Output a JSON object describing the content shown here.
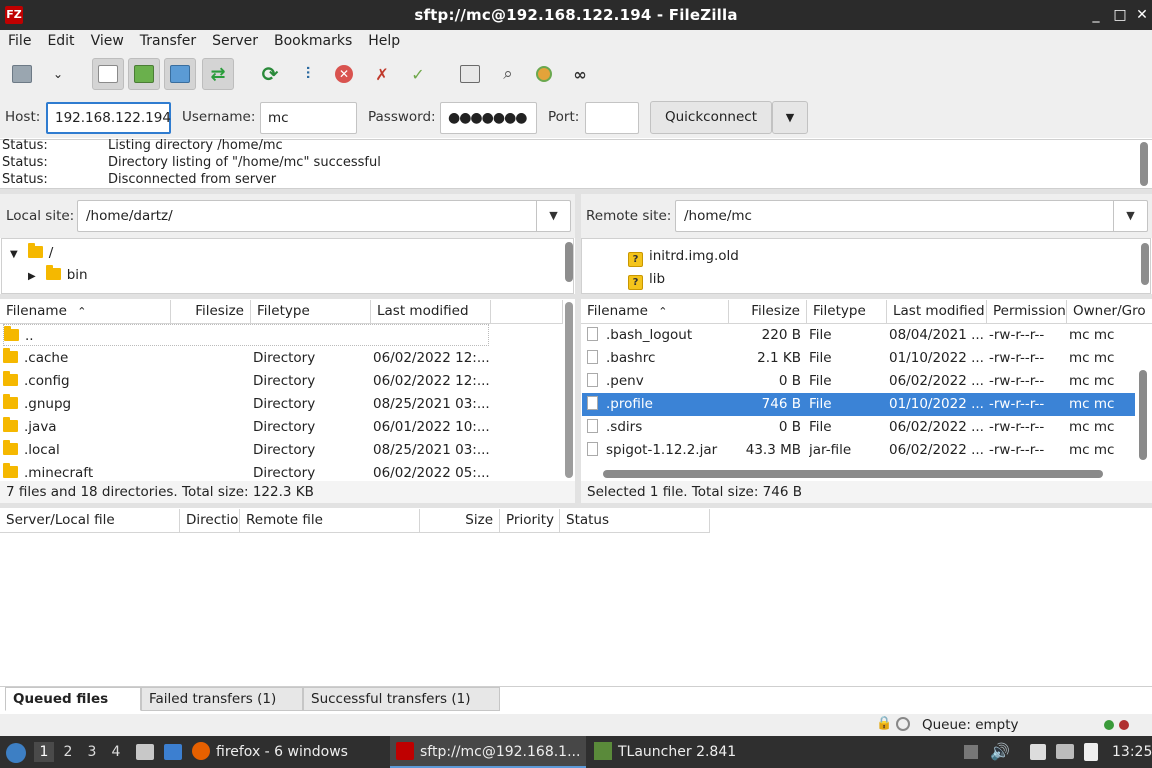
{
  "window": {
    "title": "sftp://mc@192.168.122.194 - FileZilla",
    "logo": "FZ",
    "buttons": [
      "_",
      "□",
      "✕"
    ]
  },
  "menu": [
    "File",
    "Edit",
    "View",
    "Transfer",
    "Server",
    "Bookmarks",
    "Help"
  ],
  "quickconnect": {
    "host_label": "Host:",
    "host_value": "192.168.122.194",
    "username_label": "Username:",
    "username_value": "mc",
    "password_label": "Password:",
    "password_value": "●●●●●●●",
    "port_label": "Port:",
    "port_value": "",
    "button_label": "Quickconnect"
  },
  "log": [
    {
      "key": "Status:",
      "msg": "Listing directory /home/mc"
    },
    {
      "key": "Status:",
      "msg": "Directory listing of \"/home/mc\" successful"
    },
    {
      "key": "Status:",
      "msg": "Disconnected from server"
    }
  ],
  "local": {
    "site_label": "Local site:",
    "path": "/home/dartz/",
    "tree": [
      {
        "name": "/"
      },
      {
        "name": "bin"
      }
    ],
    "headers": {
      "name": "Filename",
      "size": "Filesize",
      "type": "Filetype",
      "modified": "Last modified"
    },
    "files": [
      {
        "name": "..",
        "type": "",
        "modified": ""
      },
      {
        "name": ".cache",
        "type": "Directory",
        "modified": "06/02/2022 12:..."
      },
      {
        "name": ".config",
        "type": "Directory",
        "modified": "06/02/2022 12:..."
      },
      {
        "name": ".gnupg",
        "type": "Directory",
        "modified": "08/25/2021 03:..."
      },
      {
        "name": ".java",
        "type": "Directory",
        "modified": "06/01/2022 10:..."
      },
      {
        "name": ".local",
        "type": "Directory",
        "modified": "08/25/2021 03:..."
      },
      {
        "name": ".minecraft",
        "type": "Directory",
        "modified": "06/02/2022 05:..."
      }
    ],
    "status": "7 files and 18 directories. Total size: 122.3 KB"
  },
  "remote": {
    "site_label": "Remote site:",
    "path": "/home/mc",
    "tree": [
      {
        "name": "initrd.img.old"
      },
      {
        "name": "lib"
      }
    ],
    "headers": {
      "name": "Filename",
      "size": "Filesize",
      "type": "Filetype",
      "modified": "Last modified",
      "perm": "Permission",
      "owner": "Owner/Gro"
    },
    "files": [
      {
        "name": ".bash_logout",
        "size": "220 B",
        "type": "File",
        "modified": "08/04/2021 ...",
        "perm": "-rw-r--r--",
        "owner": "mc mc"
      },
      {
        "name": ".bashrc",
        "size": "2.1 KB",
        "type": "File",
        "modified": "01/10/2022 ...",
        "perm": "-rw-r--r--",
        "owner": "mc mc"
      },
      {
        "name": ".penv",
        "size": "0 B",
        "type": "File",
        "modified": "06/02/2022 ...",
        "perm": "-rw-r--r--",
        "owner": "mc mc"
      },
      {
        "name": ".profile",
        "size": "746 B",
        "type": "File",
        "modified": "01/10/2022 ...",
        "perm": "-rw-r--r--",
        "owner": "mc mc",
        "selected": true
      },
      {
        "name": ".sdirs",
        "size": "0 B",
        "type": "File",
        "modified": "06/02/2022 ...",
        "perm": "-rw-r--r--",
        "owner": "mc mc"
      },
      {
        "name": "spigot-1.12.2.jar",
        "size": "43.3 MB",
        "type": "jar-file",
        "modified": "06/02/2022 ...",
        "perm": "-rw-r--r--",
        "owner": "mc mc"
      }
    ],
    "status": "Selected 1 file. Total size: 746 B"
  },
  "queue": {
    "headers": [
      "Server/Local file",
      "Directio",
      "Remote file",
      "Size",
      "Priority",
      "Status"
    ],
    "tabs": [
      "Queued files",
      "Failed transfers (1)",
      "Successful transfers (1)"
    ],
    "status": "Queue: empty"
  },
  "taskbar": {
    "workspaces": [
      "1",
      "2",
      "3",
      "4"
    ],
    "tasks": [
      "firefox - 6 windows",
      "sftp://mc@192.168.1...",
      "TLauncher 2.841"
    ],
    "clock": "13:25"
  },
  "colors": {
    "selection": "#3b83d6",
    "focus": "#2f7cd0",
    "folder": "#f5b800",
    "titlebar": "#2b2b2b"
  }
}
